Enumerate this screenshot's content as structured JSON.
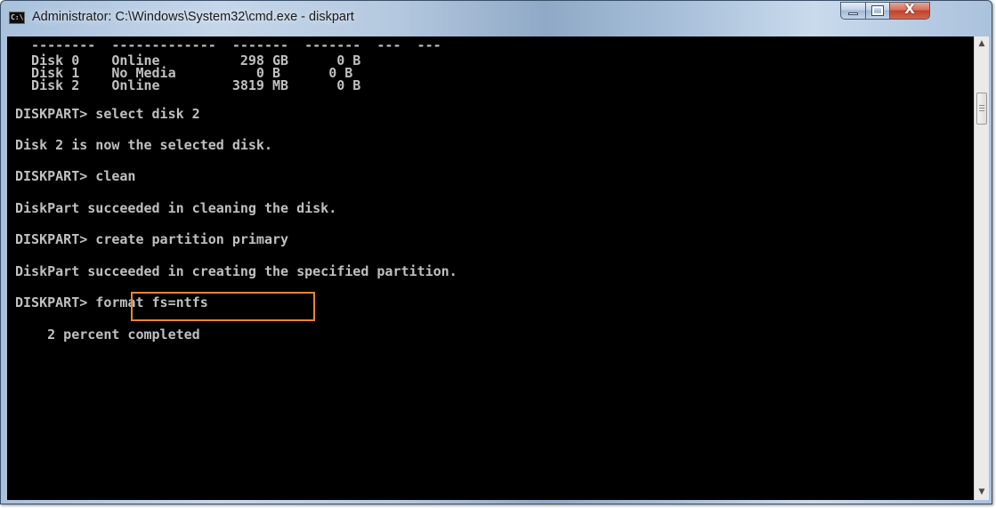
{
  "window": {
    "title": "Administrator: C:\\Windows\\System32\\cmd.exe - diskpart",
    "icon_text": "C:\\."
  },
  "controls": {
    "minimize_icon": "minimize-icon",
    "maximize_icon": "maximize-icon",
    "close_glyph": "X"
  },
  "console": {
    "lines": [
      "  --------  -------------  -------  -------  ---  ---",
      "  Disk 0    Online          298 GB      0 B",
      "  Disk 1    No Media          0 B      0 B",
      "  Disk 2    Online         3819 MB      0 B",
      "DISKPART> select disk 2",
      "Disk 2 is now the selected disk.",
      "DISKPART> clean",
      "DiskPart succeeded in cleaning the disk.",
      "DISKPART> create partition primary",
      "DiskPart succeeded in creating the specified partition.",
      "DISKPART> format fs=ntfs",
      "    2 percent completed"
    ],
    "highlighted_command": "format fs=ntfs",
    "highlight_color": "#e7862e",
    "text_color": "#c0c0c0",
    "background_color": "#000000"
  },
  "scrollbar": {
    "up_arrow": "▲",
    "down_arrow": "▼"
  }
}
